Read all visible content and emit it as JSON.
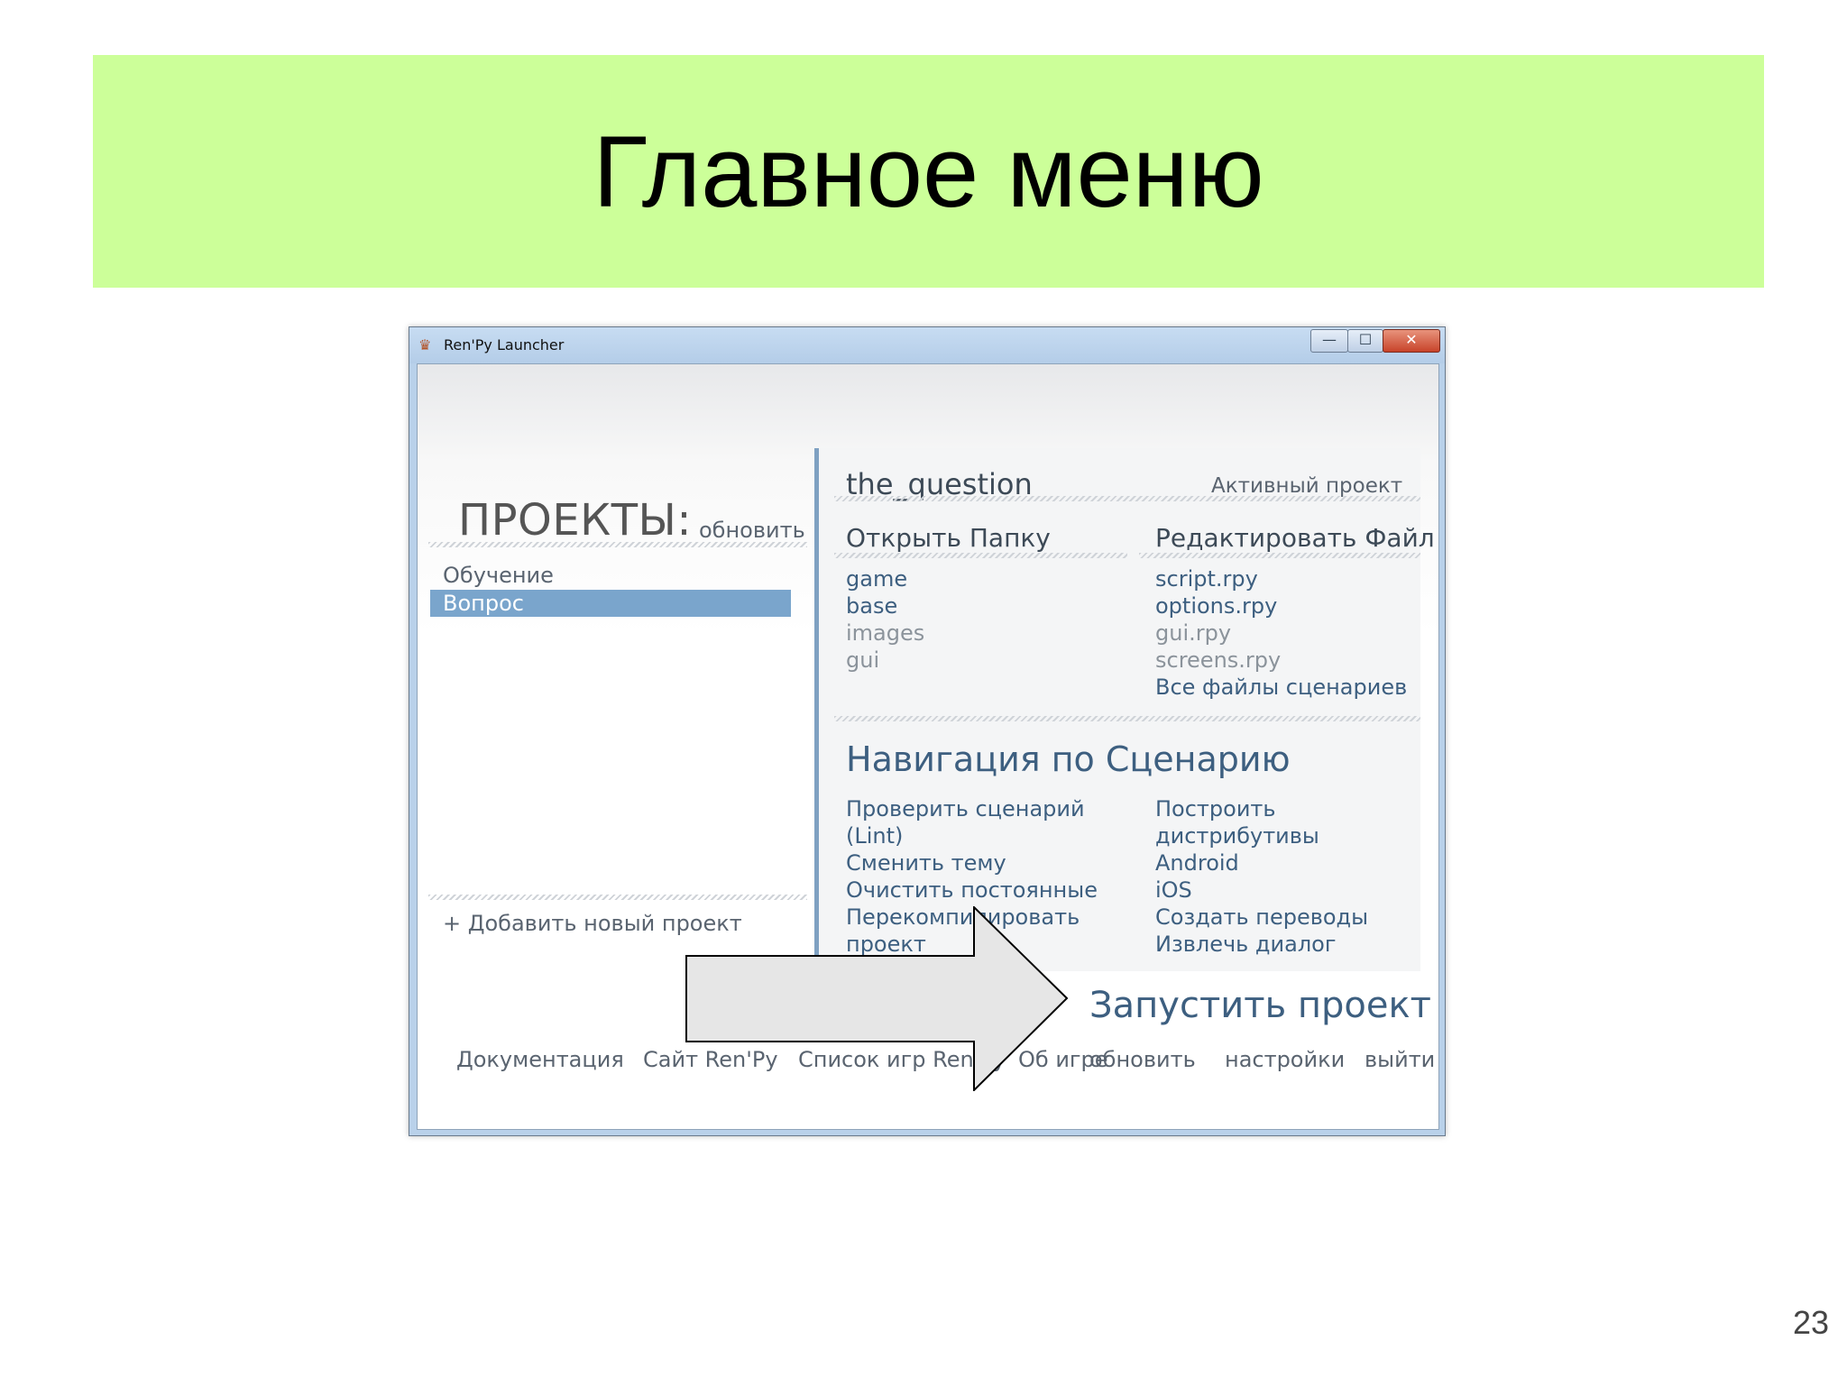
{
  "slide": {
    "title": "Главное меню",
    "number": "23",
    "header_color": "#ccff99"
  },
  "window": {
    "title": "Ren'Py Launcher",
    "controls": {
      "minimize": "—",
      "maximize": "☐",
      "close": "✕"
    }
  },
  "projects": {
    "heading": "ПРОЕКТЫ:",
    "refresh": "обновить",
    "items": [
      "Обучение",
      "Вопрос"
    ],
    "selected_index": 1,
    "add": "+ Добавить новый проект"
  },
  "active": {
    "name": "the_question",
    "label": "Активный проект"
  },
  "open_folder": {
    "heading": "Открыть Папку",
    "items": [
      "game",
      "base",
      "images",
      "gui"
    ]
  },
  "edit_file": {
    "heading": "Редактировать Файл",
    "items": [
      "script.rpy",
      "options.rpy",
      "gui.rpy",
      "screens.rpy",
      "Все файлы сценариев"
    ]
  },
  "navigation": {
    "heading": "Навигация по Сценарию",
    "left": [
      "Проверить сценарий",
      "(Lint)",
      "Сменить тему",
      "Очистить постоянные",
      "Перекомпилировать",
      "проект"
    ],
    "right": [
      "Построить",
      "дистрибутивы",
      "Android",
      "iOS",
      "Создать переводы",
      "Извлечь диалог"
    ]
  },
  "launch": "Запустить проект",
  "bottom_links": [
    "Документация",
    "Сайт Ren'Py",
    "Список игр Ren'Py",
    "Об игре",
    "обновить",
    "настройки",
    "выйти"
  ],
  "colors": {
    "selection": "#7aa5cc",
    "link": "#3d5f80",
    "separator": "#7fa1c2"
  }
}
